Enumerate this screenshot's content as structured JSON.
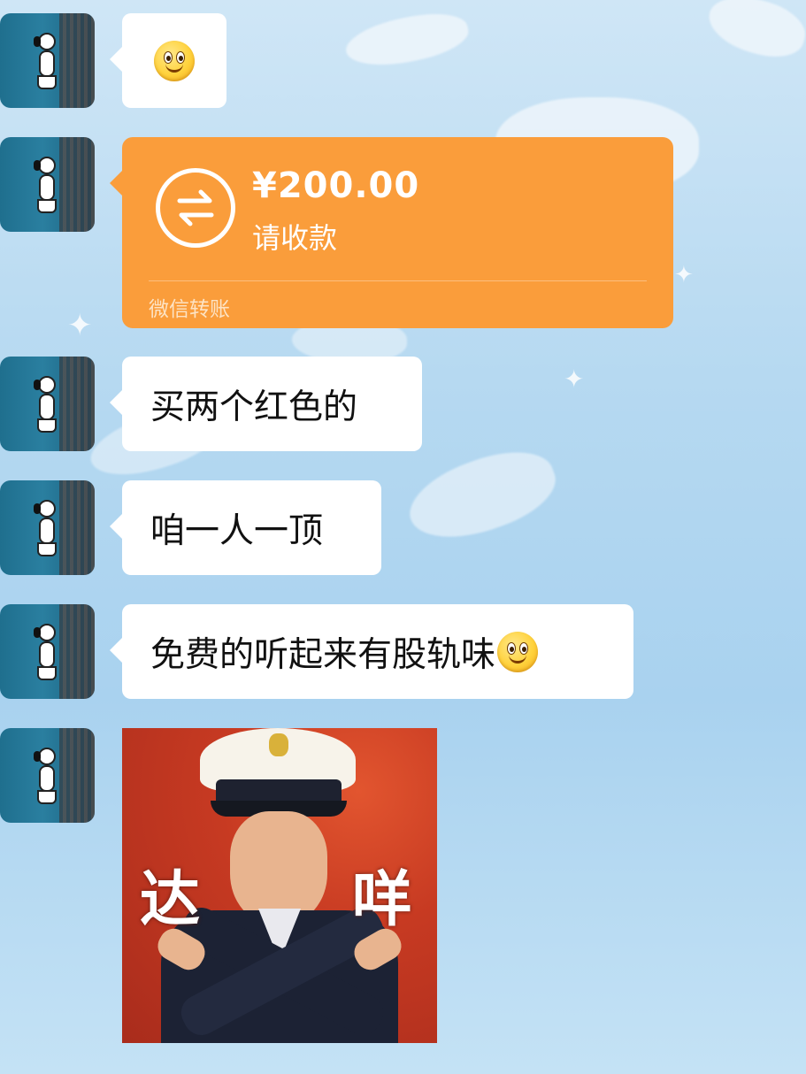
{
  "messages": [
    {
      "type": "emoji",
      "emoji": "slightly-smiling-face"
    },
    {
      "type": "transfer",
      "amount": "¥200.00",
      "status": "请收款",
      "footer": "微信转账",
      "color": "#fa9d3b"
    },
    {
      "type": "text",
      "text": "买两个红色的"
    },
    {
      "type": "text",
      "text": "咱一人一顶"
    },
    {
      "type": "text",
      "text": "免费的听起来有股轨味",
      "emoji": "slightly-smiling-face"
    },
    {
      "type": "sticker",
      "caption_left": "达",
      "caption_right": "咩"
    }
  ],
  "colors": {
    "bubble": "#ffffff",
    "transfer": "#fa9d3b"
  }
}
